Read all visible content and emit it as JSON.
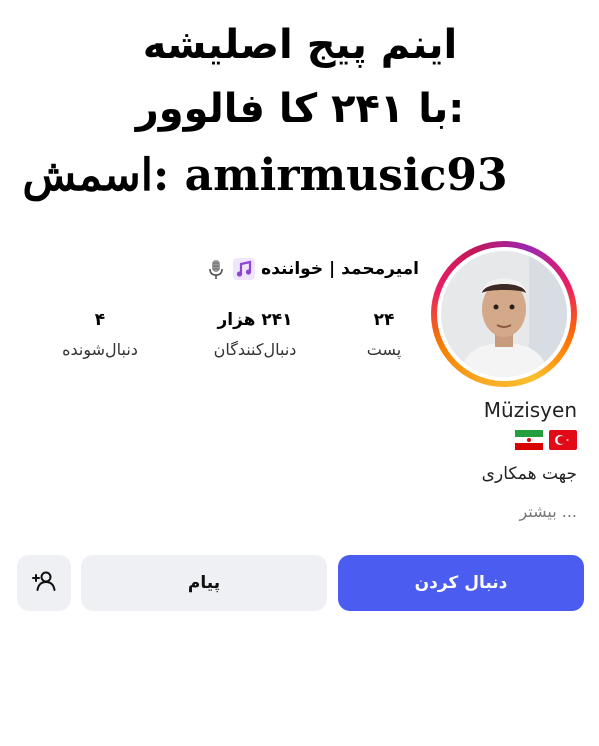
{
  "caption": {
    "line1": "اینم پیج اصلیشه",
    "line2": "با ۲۴۱ کا فالوور:",
    "line3": "اسمش: amirmusic93"
  },
  "profile": {
    "display_name": "امیرمحمد | خواننده",
    "icons": [
      "music-note-icon",
      "microphone-icon"
    ],
    "stats": {
      "posts_value": "۲۴",
      "posts_label": "پست",
      "followers_value": "۲۴۱ هزار",
      "followers_label": "دنبال‌کنندگان",
      "following_value": "۴",
      "following_label": "دنبال‌شونده"
    },
    "bio": {
      "category": "Müzisyen",
      "flags": [
        "turkey-flag-icon",
        "iran-flag-icon"
      ],
      "line": "جهت همکاری",
      "more": "... بیشتر"
    }
  },
  "actions": {
    "follow_label": "دنبال کردن",
    "message_label": "پیام",
    "suggest_icon": "add-person-icon"
  },
  "colors": {
    "follow_button": "#4a5df0",
    "secondary_button": "#eff0f3"
  }
}
